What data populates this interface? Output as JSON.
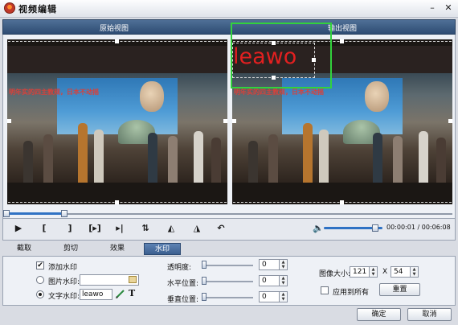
{
  "window": {
    "title": "视频编辑",
    "minimize": "–",
    "close": "✕",
    "icon": "leawo-app-icon"
  },
  "header": {
    "original_label": "原始视图",
    "output_label": "输出视图"
  },
  "preview": {
    "banner_text": "明年实的四主教规，日本不动摇",
    "watermark_text": "leawo",
    "watermark_color": "#e12020",
    "selection_color": "#32d23c"
  },
  "timeline": {
    "progress": 0.13
  },
  "controls": {
    "buttons": [
      {
        "name": "play-button",
        "icon": "play-icon",
        "glyph": "▶"
      },
      {
        "name": "mark-in-button",
        "icon": "bracket-left-icon",
        "glyph": "["
      },
      {
        "name": "mark-out-button",
        "icon": "bracket-right-icon",
        "glyph": "]"
      },
      {
        "name": "play-selection-button",
        "icon": "play-bracket-icon",
        "glyph": "[▸]"
      },
      {
        "name": "next-frame-button",
        "icon": "step-forward-icon",
        "glyph": "▸|"
      },
      {
        "name": "flip-vertical-button",
        "icon": "flip-vertical-icon",
        "glyph": "⇅"
      },
      {
        "name": "rotate-left-button",
        "icon": "rotate-left-icon",
        "glyph": "◭"
      },
      {
        "name": "rotate-right-button",
        "icon": "rotate-right-icon",
        "glyph": "◮"
      },
      {
        "name": "undo-button",
        "icon": "undo-icon",
        "glyph": "↶"
      }
    ],
    "volume_icon": "speaker-icon",
    "volume_glyph": "🔈",
    "volume_level": 0.88,
    "time_current": "00:00:01",
    "time_separator": "/",
    "time_total": "00:06:08"
  },
  "tabs": [
    {
      "label": "截取",
      "active": false
    },
    {
      "label": "剪切",
      "active": false
    },
    {
      "label": "效果",
      "active": false
    },
    {
      "label": "水印",
      "active": true
    }
  ],
  "watermark": {
    "enable_label": "添加水印",
    "enable_checked": true,
    "image_label": "图片水印:",
    "image_value": "",
    "text_label": "文字水印:",
    "text_value": "leawo",
    "text_mode_selected": true,
    "folder_icon": "folder-icon",
    "pencil_icon": "pencil-icon",
    "font_icon": "font-icon",
    "font_glyph": "T",
    "opacity_label": "透明度:",
    "opacity_value": "0",
    "h_pos_label": "水平位置:",
    "h_pos_value": "0",
    "v_pos_label": "垂直位置:",
    "v_pos_value": "0",
    "size_label": "图像大小:",
    "width_value": "121",
    "times_label": "X",
    "height_value": "54",
    "apply_all_label": "应用到所有",
    "apply_all_checked": false,
    "reset_label": "重置"
  },
  "footer": {
    "ok_label": "确定",
    "cancel_label": "取消"
  }
}
